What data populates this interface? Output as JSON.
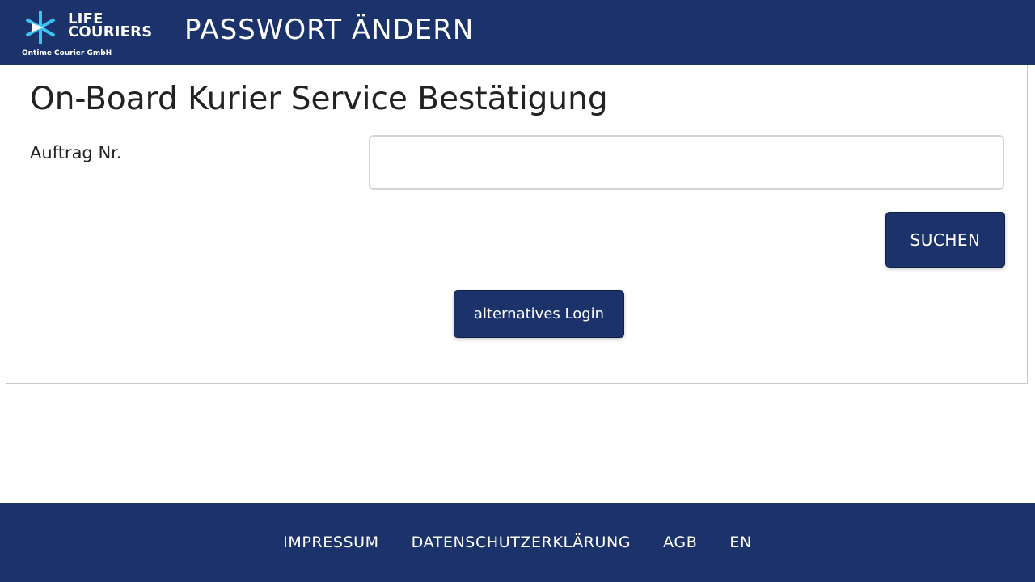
{
  "header": {
    "logo": {
      "line1": "LIFE",
      "line2": "COURIERS",
      "subtitle": "Ontime Courier GmbH"
    },
    "title": "PASSWORT ÄNDERN"
  },
  "main": {
    "title": "On-Board Kurier Service Bestätigung",
    "order_label": "Auftrag Nr.",
    "order_value": "",
    "search_label": "SUCHEN",
    "alt_login_label": "alternatives Login"
  },
  "footer": {
    "links": [
      "IMPRESSUM",
      "DATENSCHUTZERKLÄRUNG",
      "AGB",
      "EN"
    ]
  },
  "colors": {
    "brand": "#1b326a",
    "logo_accent": "#3ec1f3"
  }
}
